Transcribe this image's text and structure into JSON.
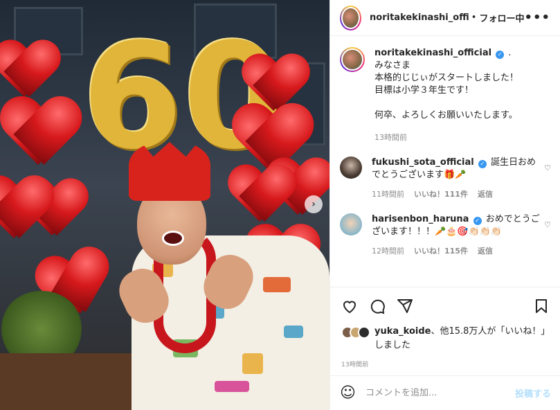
{
  "post": {
    "image_alt": "Photo of a man in a red crown with golden 60 balloons"
  },
  "header": {
    "username": "noritakekinashi_official",
    "dot": "•",
    "follow_label": "フォロー中",
    "more_label": "•••"
  },
  "caption": {
    "username": "noritakekinashi_official",
    "suffix": ".",
    "text": "みなさま\n本格的じじぃがスタートしました！\n目標は小学３年生です！\n\n何卒、よろしくお願いいたします。",
    "time": "13時間前"
  },
  "comments": [
    {
      "username": "fukushi_sota_official",
      "text": "誕生日おめでとうございます🎁🥕",
      "time": "11時間前",
      "likes": "いいね！111件",
      "reply": "返信"
    },
    {
      "username": "harisenbon_haruna",
      "text": "おめでとうございます！！！🥕🎂🎯👏🏻👏🏻👏🏻",
      "time": "12時間前",
      "likes": "いいね！115件",
      "reply": "返信"
    }
  ],
  "likes_line": {
    "user": "yuka_koide",
    "rest": "、他15.8万人が「いいね！」しました"
  },
  "post_time": "13時間前",
  "comment_box": {
    "placeholder": "コメントを追加...",
    "post_label": "投稿する"
  },
  "photo": {
    "digits": "60"
  },
  "colors": {
    "accent_blue": "#3897f0",
    "post_disabled": "#b2dffc",
    "meta_gray": "#8e8e8e"
  },
  "icons": [
    "heart-icon",
    "comment-icon",
    "share-icon",
    "bookmark-icon",
    "emoji-icon",
    "chevron-right-icon",
    "more-icon",
    "verified-icon"
  ]
}
